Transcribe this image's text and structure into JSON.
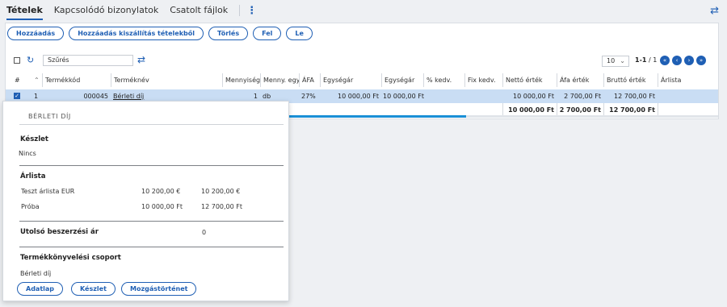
{
  "tabs": {
    "items": [
      "Tételek",
      "Kapcsolódó bizonylatok",
      "Csatolt fájlok"
    ],
    "more_icon": "kebab-vertical-icon",
    "swap_icon": "swap-arrows-icon"
  },
  "toolbar": {
    "buttons": [
      "Hozzáadás",
      "Hozzáadás kiszállítás tételekből",
      "Törlés",
      "Fel",
      "Le"
    ]
  },
  "filter": {
    "placeholder": "Szűrés",
    "refresh_icon": "refresh-icon",
    "swap_icon": "swap-arrows-icon"
  },
  "pagination": {
    "page_size": "10",
    "info_bold": "1-1",
    "info_rest": " / 1",
    "nav_icons": [
      "first-page-icon",
      "prev-page-icon",
      "next-page-icon",
      "last-page-icon"
    ]
  },
  "table": {
    "columns": [
      "#",
      "Termékkód",
      "Terméknév",
      "Mennyiség",
      "Menny. egység",
      "ÁFA",
      "Egységár",
      "Egységár",
      "% kedv.",
      "Fix kedv.",
      "Nettó érték",
      "Áfa érték",
      "Bruttó érték",
      "Árlista"
    ],
    "rows": [
      {
        "num": "1",
        "code": "000045",
        "name": "Bérleti díj",
        "qty": "1",
        "unit": "db",
        "vat": "27%",
        "unit_price": "10 000,00 Ft",
        "unit_price2": "10 000,00 Ft",
        "pct_disc": "",
        "fix_disc": "",
        "net": "10 000,00 Ft",
        "vat_value": "2 700,00 Ft",
        "gross": "12 700,00 Ft",
        "pricelist": ""
      }
    ],
    "totals": {
      "net": "10 000,00 Ft",
      "vat_value": "2 700,00 Ft",
      "gross": "12 700,00 Ft"
    }
  },
  "popup": {
    "title": "BÉRLETI DÍJ",
    "stock_heading": "Készlet",
    "stock_value": "Nincs",
    "pricelist_heading": "Árlista",
    "pricelists": [
      {
        "name": "Teszt árlista EUR",
        "net": "10 200,00 €",
        "gross": "10 200,00 €"
      },
      {
        "name": "Próba",
        "net": "10 000,00 Ft",
        "gross": "12 700,00 Ft"
      }
    ],
    "last_purchase_label": "Utolsó beszerzési ár",
    "last_purchase_value": "0",
    "accounting_group_label": "Termékkönyvelési csoport",
    "accounting_group_value": "Bérleti díj",
    "buttons": [
      "Adatlap",
      "Készlet",
      "Mozgástörténet"
    ]
  }
}
